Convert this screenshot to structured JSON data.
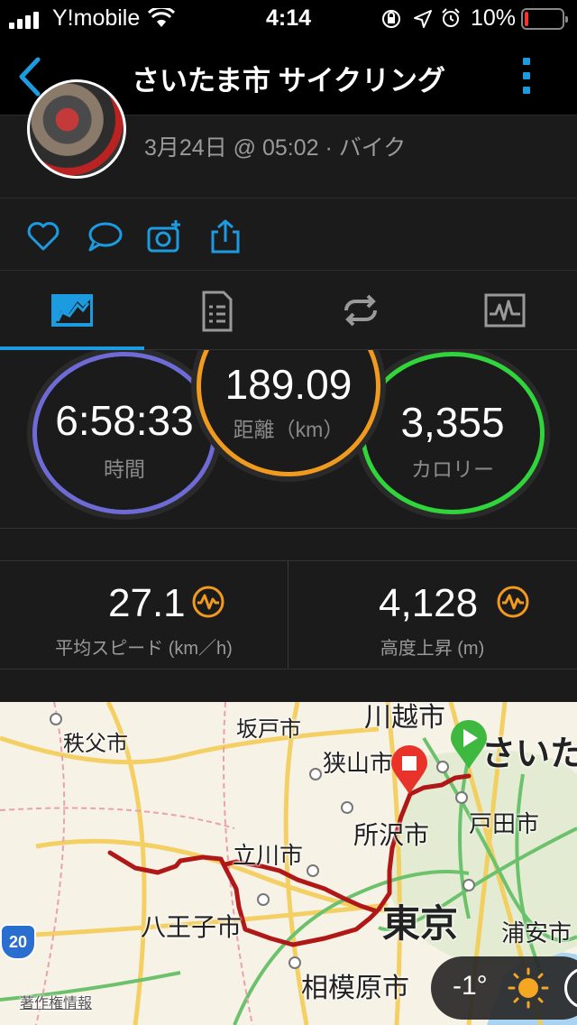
{
  "status_bar": {
    "carrier": "Y!mobile",
    "time": "4:14",
    "battery_percent": "10%",
    "battery_level": 0.1
  },
  "nav": {
    "title": "さいたま市 サイクリング"
  },
  "header": {
    "subtitle": "3月24日 @ 05:02 · バイク"
  },
  "actions": [
    "heart-icon",
    "comment-icon",
    "add-photo-icon",
    "share-icon"
  ],
  "tabs": [
    {
      "name": "summary",
      "icon": "summary-chart-icon",
      "active": true
    },
    {
      "name": "details",
      "icon": "document-list-icon",
      "active": false
    },
    {
      "name": "laps",
      "icon": "loop-icon",
      "active": false
    },
    {
      "name": "graphs",
      "icon": "heart-rate-graph-icon",
      "active": false
    }
  ],
  "stats": {
    "time": {
      "value": "6:58:33",
      "label": "時間",
      "color": "#6e6ad6"
    },
    "distance": {
      "value": "189.09",
      "label": "距離（km）",
      "color": "#f09a1e"
    },
    "calories": {
      "value": "3,355",
      "label": "カロリー",
      "color": "#2fd53a"
    }
  },
  "metrics": {
    "avg_speed": {
      "value": "27.1",
      "label": "平均スピード (km／h)"
    },
    "elevation_gain": {
      "value": "4,128",
      "label": "高度上昇 (m)"
    }
  },
  "map": {
    "labels": [
      "秩父市",
      "坂戸市",
      "川越市",
      "狭山市",
      "さいたま",
      "戸田市",
      "所沢市",
      "立川市",
      "八王子市",
      "東京",
      "浦安市",
      "相模原市",
      "著作権情報",
      "20"
    ],
    "route_color": "#b01818",
    "start_color": "#3fb83f",
    "end_color": "#e8322a",
    "weather_temp": "-1°"
  }
}
